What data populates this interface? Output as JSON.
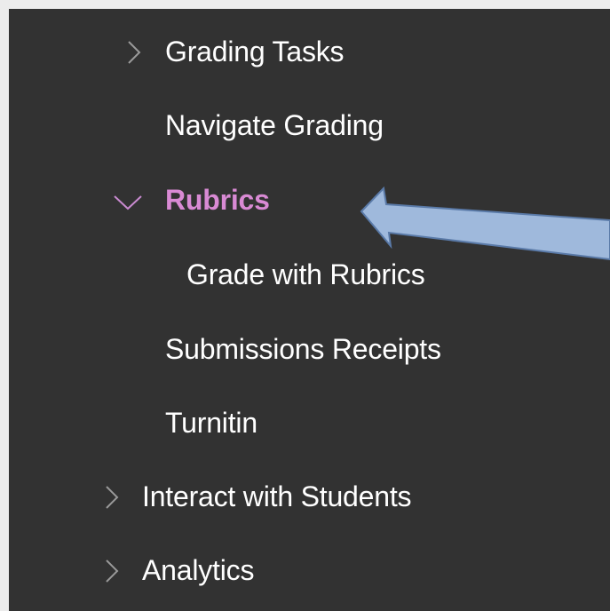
{
  "nav": {
    "items": [
      {
        "label": "Grading Tasks",
        "state": "collapsed"
      },
      {
        "label": "Navigate Grading"
      },
      {
        "label": "Rubrics",
        "state": "expanded",
        "active": true
      },
      {
        "label": "Grade with Rubrics"
      },
      {
        "label": "Submissions Receipts"
      },
      {
        "label": "Turnitin"
      },
      {
        "label": "Interact with Students",
        "state": "collapsed"
      },
      {
        "label": "Analytics",
        "state": "collapsed"
      }
    ]
  },
  "colors": {
    "panel_bg": "#323232",
    "text": "#ffffff",
    "active_text": "#d98ad4",
    "chevron": "#9a9a9a",
    "active_chevron": "#c98ad0",
    "callout_fill": "#9fb9dc",
    "callout_stroke": "#5a7aa8"
  },
  "icons": {
    "collapsed": "chevron-right-icon",
    "expanded": "chevron-down-icon",
    "callout": "pointer-arrow-icon"
  }
}
